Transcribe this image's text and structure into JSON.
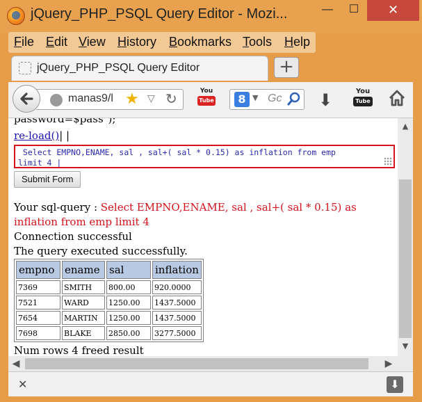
{
  "window": {
    "title": "jQuery_PHP_PSQL Query Editor - Mozi...",
    "minimize_glyph": "—",
    "maximize_glyph": "☐",
    "close_glyph": "✕"
  },
  "menu": {
    "items": [
      "File",
      "Edit",
      "View",
      "History",
      "Bookmarks",
      "Tools",
      "Help"
    ]
  },
  "tab": {
    "title": "jQuery_PHP_PSQL Query Editor",
    "new_tab_glyph": "+"
  },
  "navbar": {
    "url": "manas9/l",
    "search_placeholder": "Gc",
    "search_engine_glyph": "8"
  },
  "icons": {
    "back": "back-arrow-icon",
    "site": "globe-icon",
    "bookmark": "star-icon",
    "reload": "reload-icon",
    "youtube_addon": "youtube-icon",
    "search": "magnifier-icon",
    "downloads": "download-arrow-icon",
    "home": "home-icon"
  },
  "page": {
    "cut_off_line": "password=$pass\");",
    "reload_link": "re-load()",
    "reload_suffix": "| |",
    "query_text": " Select EMPNO,ENAME, sal , sal+( sal * 0.15) as inflation from emp\nlimit 4 |",
    "submit_label": "Submit Form",
    "sql_label": "Your sql-query : ",
    "sql_value": "Select EMPNO,ENAME, sal , sal+( sal * 0.15) as inflation from emp limit 4",
    "connection_status": "Connection successful",
    "query_status": "The query executed successfully.",
    "footer": "Num rows 4 freed result"
  },
  "results": {
    "columns": [
      "empno",
      "ename",
      "sal",
      "inflation"
    ],
    "rows": [
      [
        "7369",
        "SMITH",
        "800.00",
        "920.0000"
      ],
      [
        "7521",
        "WARD",
        "1250.00",
        "1437.5000"
      ],
      [
        "7654",
        "MARTIN",
        "1250.00",
        "1437.5000"
      ],
      [
        "7698",
        "BLAKE",
        "2850.00",
        "3277.5000"
      ]
    ]
  },
  "colors": {
    "query_border": "#d6121b",
    "sql_value_text": "#d6121b",
    "table_header_bg": "#b8c9e3",
    "link": "#1a0dab",
    "window_frame": "#e8a24f"
  },
  "scroll": {
    "up": "▲",
    "down": "▼",
    "left": "◀",
    "right": "▶"
  },
  "addon_bar": {
    "close_glyph": "✕",
    "download_glyph": "⬇"
  }
}
